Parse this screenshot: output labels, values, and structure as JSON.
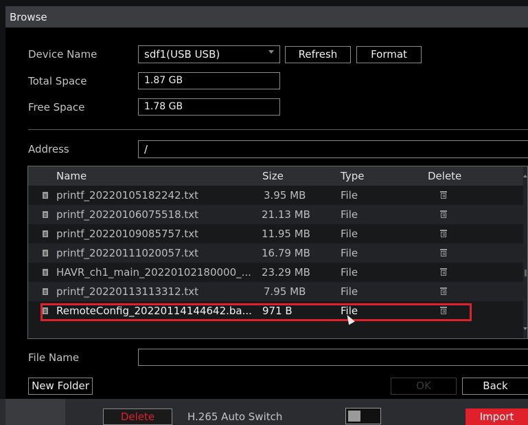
{
  "window": {
    "title": "Browse"
  },
  "form": {
    "device_name_label": "Device Name",
    "device_name_value": "sdf1(USB USB)",
    "refresh_label": "Refresh",
    "format_label": "Format",
    "total_space_label": "Total Space",
    "total_space_value": "1.87 GB",
    "free_space_label": "Free Space",
    "free_space_value": "1.78 GB",
    "address_label": "Address",
    "address_value": "/"
  },
  "table": {
    "headers": {
      "name": "Name",
      "size": "Size",
      "type": "Type",
      "delete": "Delete"
    },
    "rows": [
      {
        "name": "printf_20220105182242.txt",
        "size": "3.95 MB",
        "type": "File"
      },
      {
        "name": "printf_20220106075518.txt",
        "size": "21.13 MB",
        "type": "File"
      },
      {
        "name": "printf_20220109085757.txt",
        "size": "11.95 MB",
        "type": "File"
      },
      {
        "name": "printf_20220111020057.txt",
        "size": "16.79 MB",
        "type": "File"
      },
      {
        "name": "HAVR_ch1_main_20220102180000_...",
        "size": "23.29 MB",
        "type": "File"
      },
      {
        "name": "printf_20220113113312.txt",
        "size": "7.95 MB",
        "type": "File"
      },
      {
        "name": "RemoteConfig_20220114144642.ba...",
        "size": "971 B",
        "type": "File"
      }
    ],
    "selected_row_index": 6
  },
  "file_name": {
    "label": "File Name",
    "value": ""
  },
  "actions": {
    "new_folder_label": "New Folder",
    "ok_label": "OK",
    "back_label": "Back"
  },
  "bottom": {
    "delete_label": "Delete",
    "h265_label": "H.265 Auto Switch",
    "h265_enabled": false,
    "import_label": "Import"
  },
  "colors": {
    "accent_red": "#e0202a",
    "title_bar": "#3b3c40",
    "background": "#000000"
  }
}
